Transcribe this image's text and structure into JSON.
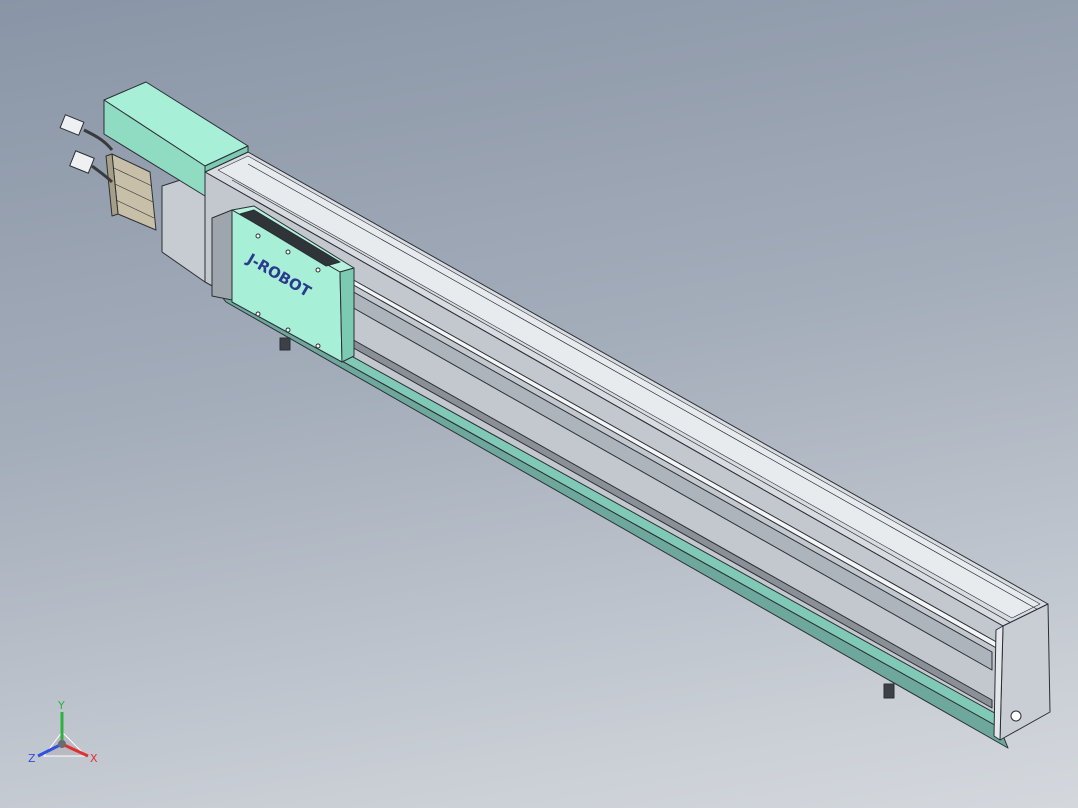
{
  "viewport": {
    "background_top": "#8995a6",
    "background_bottom": "#d4d8dd"
  },
  "model": {
    "logo_text": "J-ROBOT",
    "logo_color": "#2a3a8c",
    "carriage_color": "#a8efd8",
    "motor_box_color": "#a8efd8",
    "rail_color": "#c2c8ce",
    "edge_color": "#2b2f35"
  },
  "triad": {
    "x_label": "X",
    "y_label": "Y",
    "z_label": "Z",
    "x_color": "#e03030",
    "y_color": "#30b040",
    "z_color": "#3050e0"
  }
}
